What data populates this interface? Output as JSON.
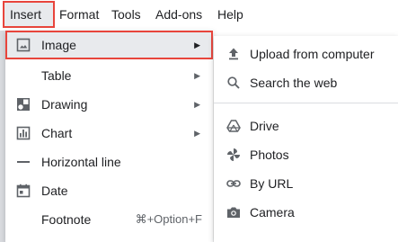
{
  "menubar": {
    "items": [
      {
        "label": "Insert"
      },
      {
        "label": "Format"
      },
      {
        "label": "Tools"
      },
      {
        "label": "Add-ons"
      },
      {
        "label": "Help"
      }
    ]
  },
  "insert_menu": {
    "items": [
      {
        "label": "Image",
        "icon": "image-icon",
        "has_submenu": true
      },
      {
        "label": "Table",
        "icon": "",
        "has_submenu": true
      },
      {
        "label": "Drawing",
        "icon": "drawing-icon",
        "has_submenu": true
      },
      {
        "label": "Chart",
        "icon": "chart-icon",
        "has_submenu": true
      },
      {
        "label": "Horizontal line",
        "icon": "horizontal-line-icon",
        "has_submenu": false
      },
      {
        "label": "Date",
        "icon": "calendar-icon",
        "has_submenu": false
      },
      {
        "label": "Footnote",
        "icon": "",
        "shortcut": "⌘+Option+F"
      }
    ]
  },
  "image_submenu": {
    "items": [
      {
        "label": "Upload from computer",
        "icon": "upload-icon"
      },
      {
        "label": "Search the web",
        "icon": "search-icon"
      },
      {
        "label": "Drive",
        "icon": "drive-icon"
      },
      {
        "label": "Photos",
        "icon": "photos-icon"
      },
      {
        "label": "By URL",
        "icon": "link-icon"
      },
      {
        "label": "Camera",
        "icon": "camera-icon"
      }
    ]
  },
  "colors": {
    "highlight_outline": "#e8453c",
    "highlight_bg": "#e8eaed",
    "icon": "#5f6368",
    "text": "#202124"
  }
}
